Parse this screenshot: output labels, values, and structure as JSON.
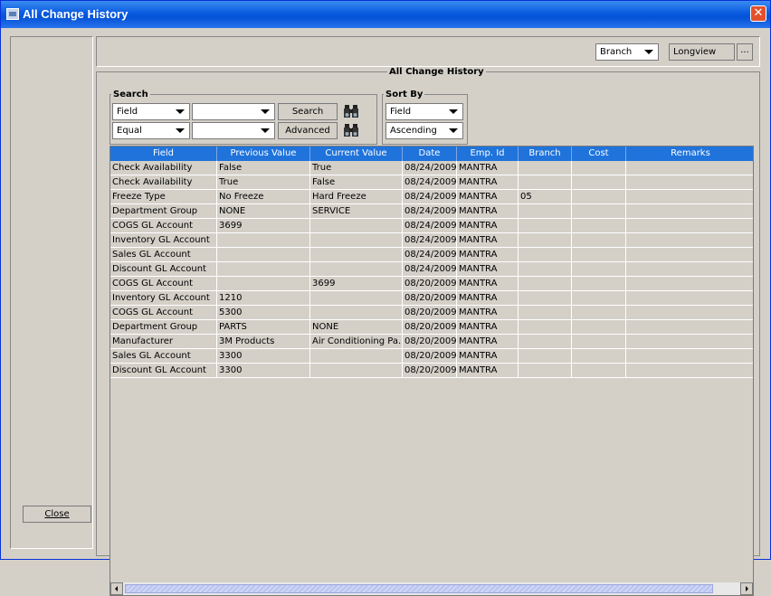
{
  "window": {
    "title": "All Change History"
  },
  "left": {
    "close_label": "Close"
  },
  "top": {
    "branch_select": "Branch",
    "branch_value": "Longview",
    "browse_label": "..."
  },
  "panel": {
    "title": "All Change History"
  },
  "search": {
    "label": "Search",
    "field_select": "Field",
    "operator_select": "Equal",
    "value1": "",
    "value2": "",
    "search_button": "Search",
    "advanced_button": "Advanced"
  },
  "sort": {
    "label": "Sort By",
    "field_select": "Field",
    "order_select": "Ascending"
  },
  "table": {
    "columns": [
      "Field",
      "Previous Value",
      "Current Value",
      "Date",
      "Emp. Id",
      "Branch",
      "Cost",
      "Remarks"
    ],
    "rows": [
      [
        "Check Availability",
        "False",
        "True",
        "08/24/2009",
        "MANTRA",
        "",
        "",
        ""
      ],
      [
        "Check Availability",
        "True",
        "False",
        "08/24/2009",
        "MANTRA",
        "",
        "",
        ""
      ],
      [
        "Freeze Type",
        "No Freeze",
        "Hard Freeze",
        "08/24/2009",
        "MANTRA",
        "05",
        "",
        ""
      ],
      [
        "Department Group",
        "NONE",
        "SERVICE",
        "08/24/2009",
        "MANTRA",
        "",
        "",
        ""
      ],
      [
        "COGS GL Account",
        "3699",
        "",
        "08/24/2009",
        "MANTRA",
        "",
        "",
        ""
      ],
      [
        "Inventory GL Account",
        "",
        "",
        "08/24/2009",
        "MANTRA",
        "",
        "",
        ""
      ],
      [
        "Sales GL Account",
        "",
        "",
        "08/24/2009",
        "MANTRA",
        "",
        "",
        ""
      ],
      [
        "Discount GL Account",
        "",
        "",
        "08/24/2009",
        "MANTRA",
        "",
        "",
        ""
      ],
      [
        "COGS GL Account",
        "",
        "3699",
        "08/20/2009",
        "MANTRA",
        "",
        "",
        ""
      ],
      [
        "Inventory GL Account",
        "1210",
        "",
        "08/20/2009",
        "MANTRA",
        "",
        "",
        ""
      ],
      [
        "COGS GL Account",
        "5300",
        "",
        "08/20/2009",
        "MANTRA",
        "",
        "",
        ""
      ],
      [
        "Department Group",
        "PARTS",
        "NONE",
        "08/20/2009",
        "MANTRA",
        "",
        "",
        ""
      ],
      [
        "Manufacturer",
        "3M Products",
        "Air Conditioning Pa...",
        "08/20/2009",
        "MANTRA",
        "",
        "",
        ""
      ],
      [
        "Sales GL Account",
        "3300",
        "",
        "08/20/2009",
        "MANTRA",
        "",
        "",
        ""
      ],
      [
        "Discount GL Account",
        "3300",
        "",
        "08/20/2009",
        "MANTRA",
        "",
        "",
        ""
      ]
    ]
  },
  "colors": {
    "header_bg": "#1f73db",
    "title_bar": "#0a5be0",
    "close_red": "#e2512b"
  }
}
